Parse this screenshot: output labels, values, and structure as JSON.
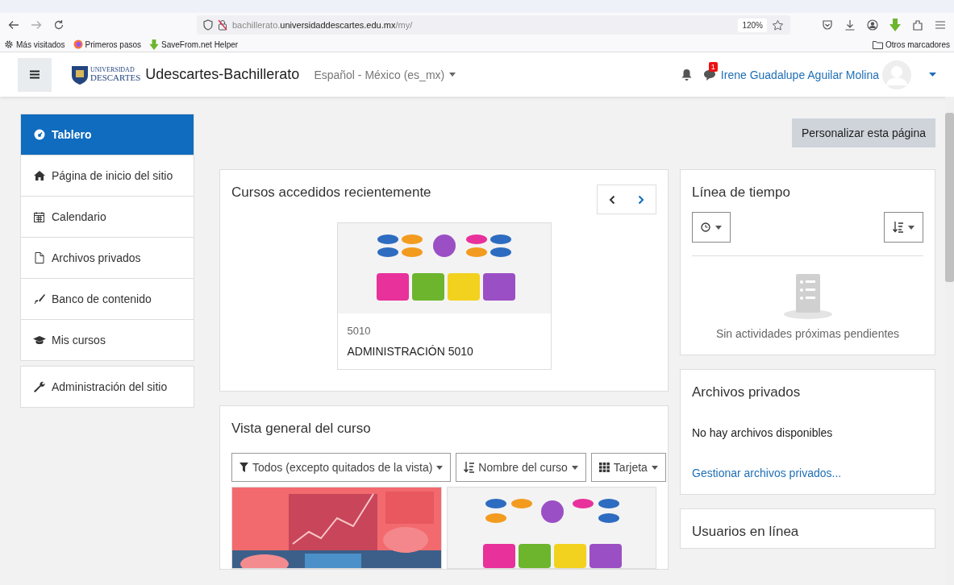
{
  "browser": {
    "url_host": "bachillerato.",
    "url_domain": "universidaddescartes.edu.mx",
    "url_path": "/my/",
    "zoom": "120%",
    "bookmarks": [
      {
        "label": "Más visitados"
      },
      {
        "label": "Primeros pasos"
      },
      {
        "label": "SaveFrom.net Helper"
      }
    ],
    "other_bookmarks": "Otros marcadores"
  },
  "header": {
    "logo_top": "UNIVERSIDAD",
    "logo_bottom": "DESCARTES",
    "site_name": "Udescartes-Bachillerato",
    "language": "Español - México (es_mx)",
    "message_count": "1",
    "user_name": "Irene Guadalupe Aguilar Molina"
  },
  "sidebar": {
    "items": [
      {
        "label": "Tablero",
        "selected": true
      },
      {
        "label": "Página de inicio del sitio",
        "selected": false
      },
      {
        "label": "Calendario",
        "selected": false
      },
      {
        "label": "Archivos privados",
        "selected": false
      },
      {
        "label": "Banco de contenido",
        "selected": false
      },
      {
        "label": "Mis cursos",
        "selected": false
      }
    ],
    "admin": {
      "label": "Administración del sitio",
      "selected": false
    }
  },
  "customize_button": "Personalizar esta página",
  "recent_courses": {
    "title": "Cursos accedidos recientemente",
    "courses": [
      {
        "category": "5010",
        "name": "ADMINISTRACIÓN 5010"
      }
    ]
  },
  "overview": {
    "title": "Vista general del curso",
    "filters": [
      {
        "label": "Todos (excepto quitados de la vista)"
      },
      {
        "label": "Nombre del curso"
      },
      {
        "label": "Tarjeta"
      }
    ]
  },
  "timeline": {
    "title": "Línea de tiempo",
    "empty": "Sin actividades próximas pendientes"
  },
  "private_files": {
    "title": "Archivos privados",
    "empty": "No hay archivos disponibles",
    "link": "Gestionar archivos privados..."
  },
  "online_users": {
    "title": "Usuarios en línea"
  }
}
